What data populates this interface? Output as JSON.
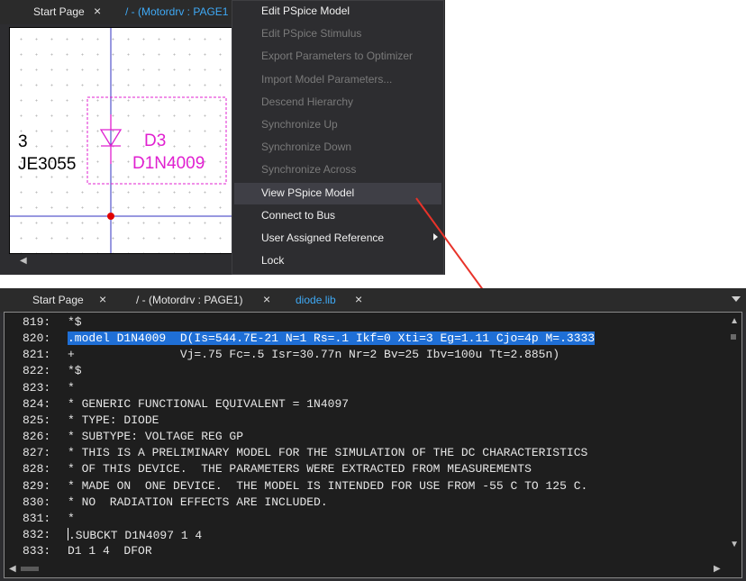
{
  "top_tabs": {
    "start_page": "Start Page",
    "close_glyph": "×",
    "active_tab": "/ - (Motordrv : PAGE1"
  },
  "schematic": {
    "left_ref_partial": "3",
    "left_part_partial": "JE3055",
    "diode_ref": "D3",
    "diode_part": "D1N4009",
    "wire_color": "#3030c0",
    "part_color": "#e020d0",
    "node_color": "#e00000"
  },
  "context_menu": {
    "items": [
      {
        "label": "Edit PSpice Model",
        "enabled": true
      },
      {
        "label": "Edit PSpice Stimulus",
        "enabled": false
      },
      {
        "label": "Export Parameters to Optimizer",
        "enabled": false
      },
      {
        "label": "Import Model Parameters...",
        "enabled": false
      },
      {
        "label": "Descend Hierarchy",
        "enabled": false
      },
      {
        "label": "Synchronize Up",
        "enabled": false
      },
      {
        "label": "Synchronize Down",
        "enabled": false
      },
      {
        "label": "Synchronize Across",
        "enabled": false
      },
      {
        "label": "View PSpice Model",
        "enabled": true,
        "highlighted": true
      },
      {
        "label": "Connect to Bus",
        "enabled": true
      },
      {
        "label": "User Assigned Reference",
        "enabled": true,
        "submenu": true
      },
      {
        "label": "Lock",
        "enabled": true
      }
    ]
  },
  "annotation_arrow_color": "#e8332a",
  "bottom_tabs": {
    "start_page": "Start Page",
    "schematic_tab": "/ - (Motordrv : PAGE1)",
    "active_tab": "diode.lib",
    "close_glyph": "×"
  },
  "editor": {
    "selection_color": "#1f6fd6",
    "lines": [
      {
        "num": "819:",
        "text": "*$"
      },
      {
        "num": "820:",
        "text": ".model D1N4009  D(Is=544.7E-21 N=1 Rs=.1 Ikf=0 Xti=3 Eg=1.11 Cjo=4p M=.3333",
        "selected": true
      },
      {
        "num": "821:",
        "text": "+               Vj=.75 Fc=.5 Isr=30.77n Nr=2 Bv=25 Ibv=100u Tt=2.885n)"
      },
      {
        "num": "822:",
        "text": "*$"
      },
      {
        "num": "823:",
        "text": "*"
      },
      {
        "num": "824:",
        "text": "* GENERIC FUNCTIONAL EQUIVALENT = 1N4097"
      },
      {
        "num": "825:",
        "text": "* TYPE: DIODE"
      },
      {
        "num": "826:",
        "text": "* SUBTYPE: VOLTAGE REG GP"
      },
      {
        "num": "827:",
        "text": "* THIS IS A PRELIMINARY MODEL FOR THE SIMULATION OF THE DC CHARACTERISTICS"
      },
      {
        "num": "828:",
        "text": "* OF THIS DEVICE.  THE PARAMETERS WERE EXTRACTED FROM MEASUREMENTS"
      },
      {
        "num": "829:",
        "text": "* MADE ON  ONE DEVICE.  THE MODEL IS INTENDED FOR USE FROM -55 C TO 125 C."
      },
      {
        "num": "830:",
        "text": "* NO  RADIATION EFFECTS ARE INCLUDED."
      },
      {
        "num": "831:",
        "text": "*"
      },
      {
        "num": "832:",
        "text": ".SUBCKT D1N4097 1 4",
        "caret": true
      },
      {
        "num": "833:",
        "text": "D1 1 4  DFOR"
      }
    ]
  }
}
